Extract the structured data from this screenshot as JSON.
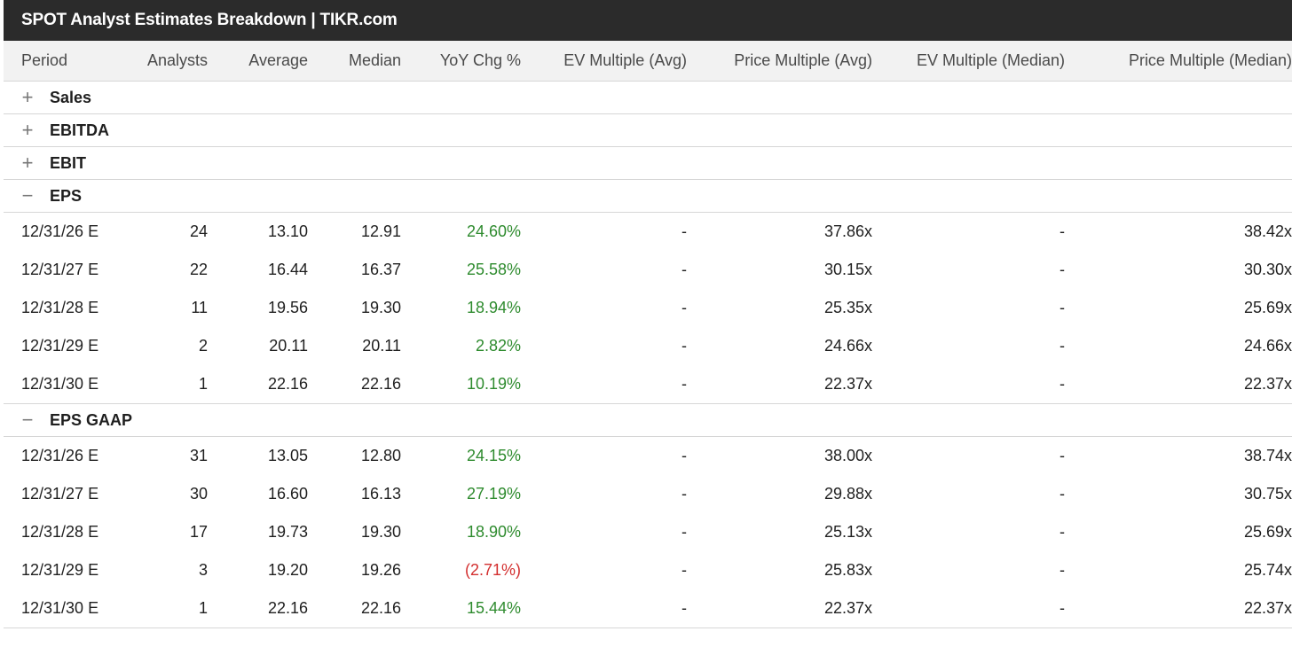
{
  "title": "SPOT Analyst Estimates Breakdown | TIKR.com",
  "columns": [
    "Period",
    "Analysts",
    "Average",
    "Median",
    "YoY Chg %",
    "EV Multiple (Avg)",
    "Price Multiple (Avg)",
    "EV Multiple (Median)",
    "Price Multiple (Median)"
  ],
  "icons": {
    "expand": "plus-icon",
    "collapse": "minus-icon",
    "expand_glyph": "+",
    "collapse_glyph": "−"
  },
  "colors": {
    "positive": "#2e8b2e",
    "negative": "#d32f2f",
    "title_bg": "#2b2b2b",
    "header_bg": "#f2f2f2"
  },
  "sections": [
    {
      "name": "Sales",
      "expanded": false
    },
    {
      "name": "EBITDA",
      "expanded": false
    },
    {
      "name": "EBIT",
      "expanded": false
    },
    {
      "name": "EPS",
      "expanded": true,
      "rows": [
        {
          "period": "12/31/26 E",
          "analysts": "24",
          "average": "13.10",
          "median": "12.91",
          "yoy": "24.60%",
          "yoy_sign": "pos",
          "ev_avg": "-",
          "price_avg": "37.86x",
          "ev_median": "-",
          "price_median": "38.42x"
        },
        {
          "period": "12/31/27 E",
          "analysts": "22",
          "average": "16.44",
          "median": "16.37",
          "yoy": "25.58%",
          "yoy_sign": "pos",
          "ev_avg": "-",
          "price_avg": "30.15x",
          "ev_median": "-",
          "price_median": "30.30x"
        },
        {
          "period": "12/31/28 E",
          "analysts": "11",
          "average": "19.56",
          "median": "19.30",
          "yoy": "18.94%",
          "yoy_sign": "pos",
          "ev_avg": "-",
          "price_avg": "25.35x",
          "ev_median": "-",
          "price_median": "25.69x"
        },
        {
          "period": "12/31/29 E",
          "analysts": "2",
          "average": "20.11",
          "median": "20.11",
          "yoy": "2.82%",
          "yoy_sign": "pos",
          "ev_avg": "-",
          "price_avg": "24.66x",
          "ev_median": "-",
          "price_median": "24.66x"
        },
        {
          "period": "12/31/30 E",
          "analysts": "1",
          "average": "22.16",
          "median": "22.16",
          "yoy": "10.19%",
          "yoy_sign": "pos",
          "ev_avg": "-",
          "price_avg": "22.37x",
          "ev_median": "-",
          "price_median": "22.37x"
        }
      ]
    },
    {
      "name": "EPS GAAP",
      "expanded": true,
      "rows": [
        {
          "period": "12/31/26 E",
          "analysts": "31",
          "average": "13.05",
          "median": "12.80",
          "yoy": "24.15%",
          "yoy_sign": "pos",
          "ev_avg": "-",
          "price_avg": "38.00x",
          "ev_median": "-",
          "price_median": "38.74x"
        },
        {
          "period": "12/31/27 E",
          "analysts": "30",
          "average": "16.60",
          "median": "16.13",
          "yoy": "27.19%",
          "yoy_sign": "pos",
          "ev_avg": "-",
          "price_avg": "29.88x",
          "ev_median": "-",
          "price_median": "30.75x"
        },
        {
          "period": "12/31/28 E",
          "analysts": "17",
          "average": "19.73",
          "median": "19.30",
          "yoy": "18.90%",
          "yoy_sign": "pos",
          "ev_avg": "-",
          "price_avg": "25.13x",
          "ev_median": "-",
          "price_median": "25.69x"
        },
        {
          "period": "12/31/29 E",
          "analysts": "3",
          "average": "19.20",
          "median": "19.26",
          "yoy": "(2.71%)",
          "yoy_sign": "neg",
          "ev_avg": "-",
          "price_avg": "25.83x",
          "ev_median": "-",
          "price_median": "25.74x"
        },
        {
          "period": "12/31/30 E",
          "analysts": "1",
          "average": "22.16",
          "median": "22.16",
          "yoy": "15.44%",
          "yoy_sign": "pos",
          "ev_avg": "-",
          "price_avg": "22.37x",
          "ev_median": "-",
          "price_median": "22.37x"
        }
      ]
    }
  ]
}
